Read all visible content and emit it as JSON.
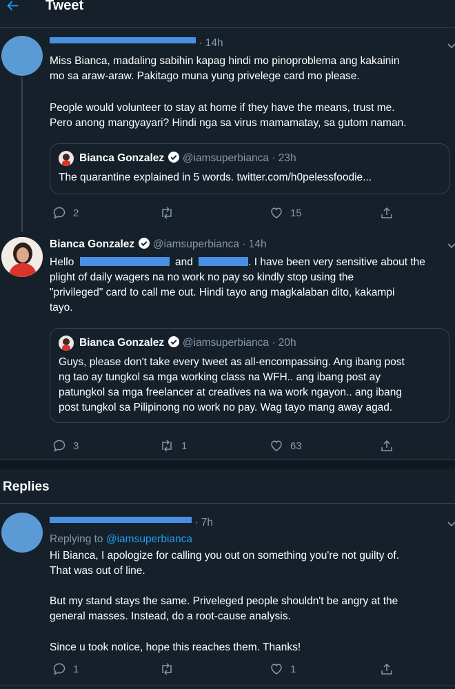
{
  "header": {
    "title": "Tweet",
    "back_icon": "arrow-left-icon"
  },
  "tweet1": {
    "time": "· 14h",
    "lines": [
      "Miss Bianca, madaling sabihin kapag hindi mo pinoproblema ang kakainin",
      "mo sa araw-araw. Pakitago muna yung privelege card mo please.",
      "People would volunteer to stay at home if they have the means, trust me.",
      "Pero anong mangyayari? Hindi nga sa virus mamamatay, sa gutom naman."
    ],
    "quote": {
      "name": "Bianca Gonzalez",
      "handle": "@iamsuperbianca · 23h",
      "text": "The quarantine explained in 5 words. twitter.com/h0pelessfoodie..."
    },
    "replies": "2",
    "likes": "15"
  },
  "tweet2": {
    "name": "Bianca Gonzalez",
    "handle": "@iamsuperbianca · 14h",
    "line1_a": "Hello",
    "line1_b": "and",
    "line1_c": ". I have been very sensitive about the",
    "lines": [
      "plight of daily wagers na no work no pay so kindly stop using the",
      "\"privileged\" card to call me out. Hindi tayo ang magkalaban dito, kakampi",
      "tayo."
    ],
    "quote": {
      "name": "Bianca Gonzalez",
      "handle": "@iamsuperbianca · 20h",
      "lines": [
        "Guys, please don't take every tweet as all-encompassing. Ang ibang post",
        "ng tao ay tungkol sa mga working class na WFH.. ang ibang post ay",
        "patungkol sa mga freelancer at creatives na wa work ngayon.. ang ibang",
        "post tungkol sa Pilipinong no work no pay. Wag tayo mang away agad."
      ]
    },
    "replies": "3",
    "retweets": "1",
    "likes": "63"
  },
  "replies_heading": "Replies",
  "reply1": {
    "time": "· 7h",
    "replying_to_label": "Replying to",
    "replying_to_handle": "@iamsuperbianca",
    "lines": [
      "Hi Bianca, I apologize for calling you out on something you're not guilty of.",
      "That was out of line.",
      "But my stand stays the same. Priveleged people shouldn't be angry at the",
      "general masses. Instead, do a root-cause analysis.",
      "Since u took notice, hope this reaches them. Thanks!"
    ],
    "replies": "1",
    "likes": "1"
  },
  "colors": {
    "background": "#15202b",
    "accent": "#1da1f2",
    "muted": "#8899a6",
    "redaction": "#4a90e2"
  }
}
